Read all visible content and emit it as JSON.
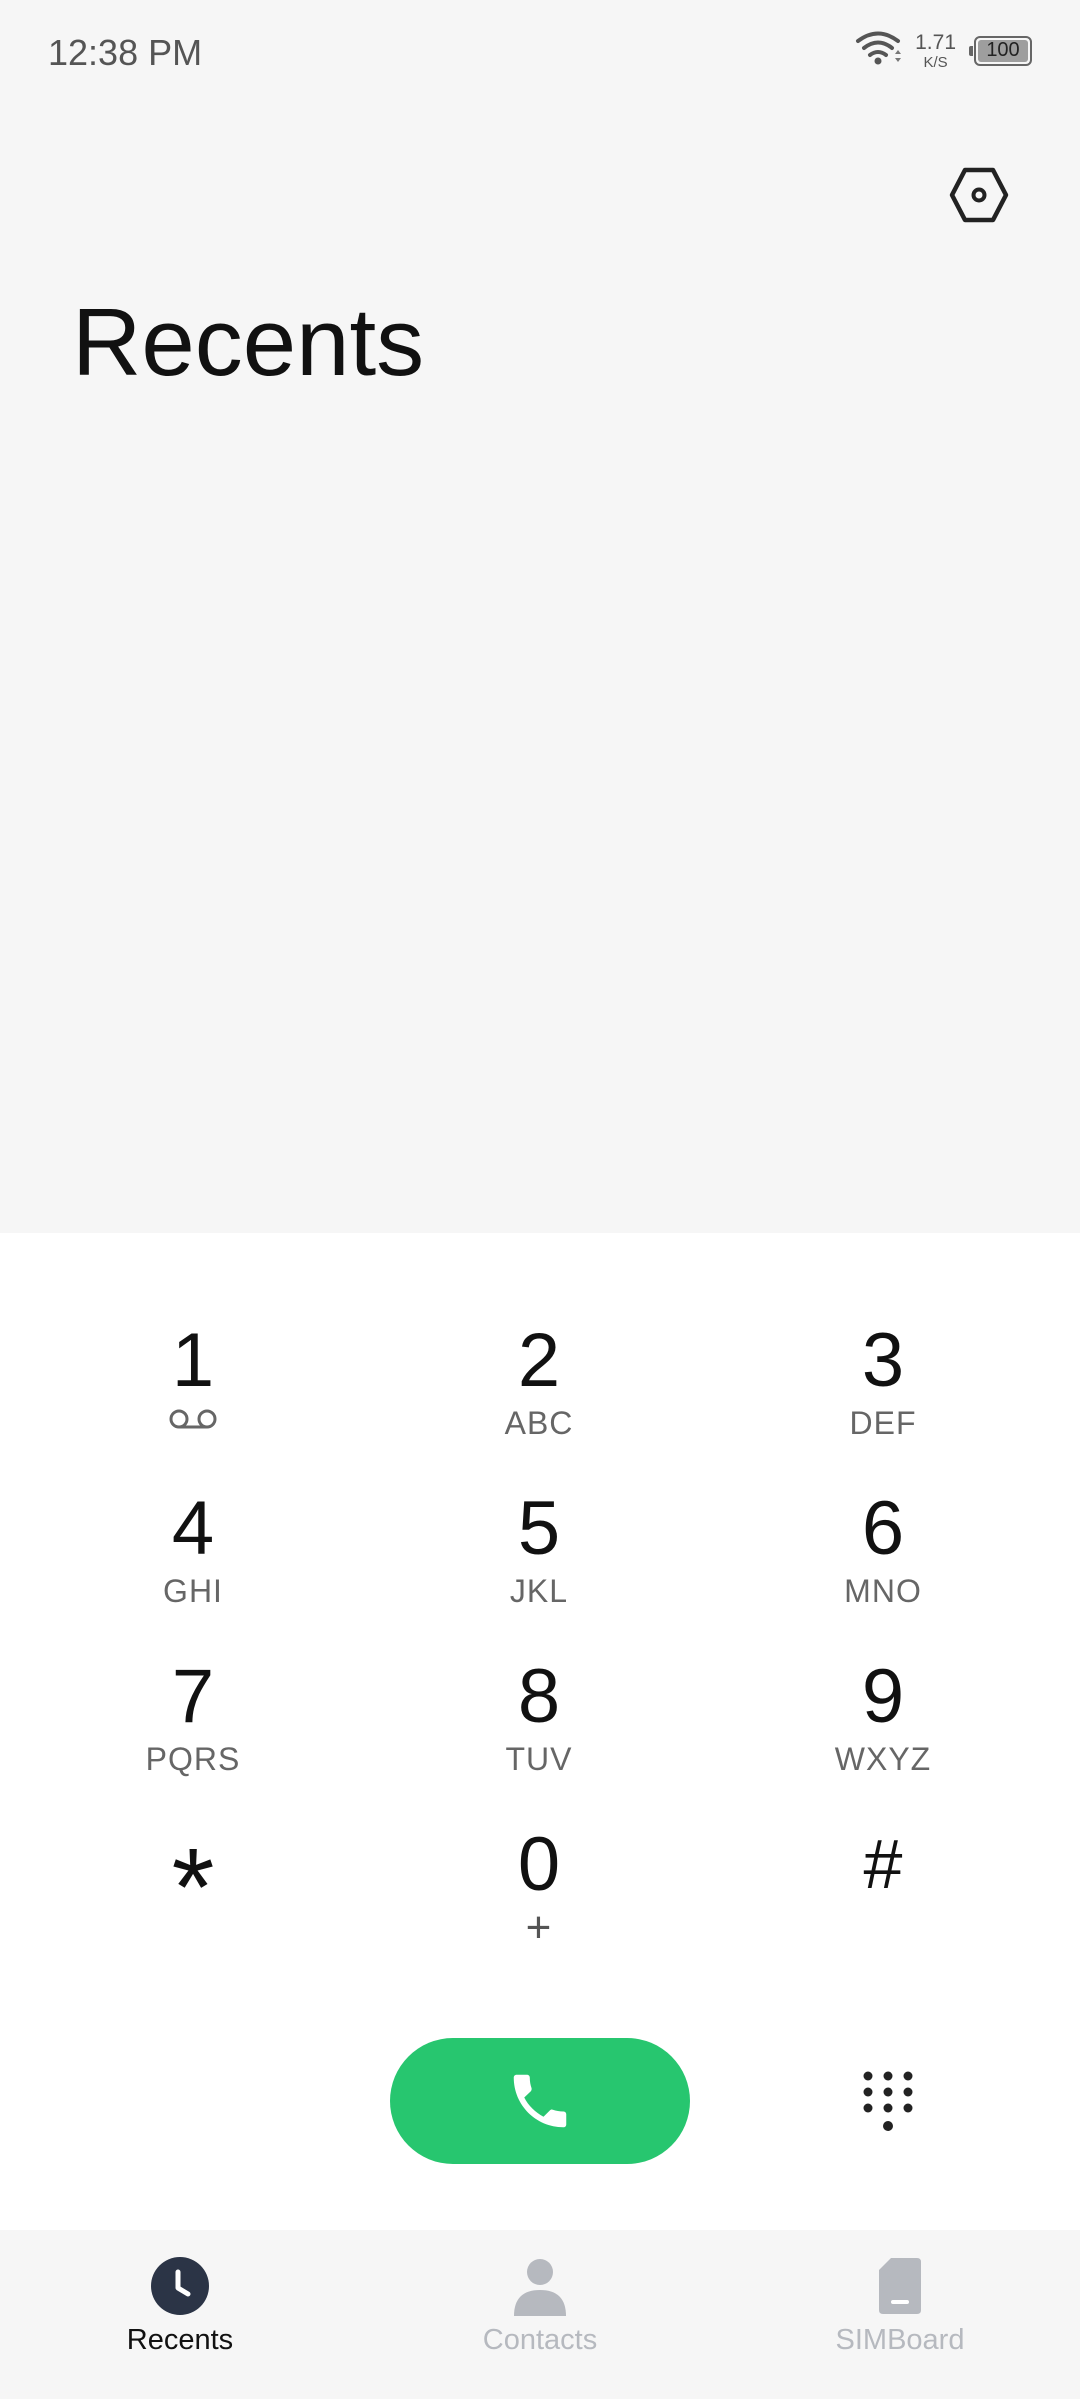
{
  "status_bar": {
    "time": "12:38 PM",
    "net_speed_value": "1.71",
    "net_speed_unit": "K/S",
    "battery": "100",
    "icons": [
      "wifi-icon",
      "battery-icon"
    ]
  },
  "header": {
    "title": "Recents",
    "settings_icon": "settings-hexagon-icon"
  },
  "dialpad": {
    "keys": [
      {
        "digit": "1",
        "letters": "",
        "icon": "voicemail-icon"
      },
      {
        "digit": "2",
        "letters": "ABC"
      },
      {
        "digit": "3",
        "letters": "DEF"
      },
      {
        "digit": "4",
        "letters": "GHI"
      },
      {
        "digit": "5",
        "letters": "JKL"
      },
      {
        "digit": "6",
        "letters": "MNO"
      },
      {
        "digit": "7",
        "letters": "PQRS"
      },
      {
        "digit": "8",
        "letters": "TUV"
      },
      {
        "digit": "9",
        "letters": "WXYZ"
      },
      {
        "digit": "*",
        "letters": ""
      },
      {
        "digit": "0",
        "letters": "+"
      },
      {
        "digit": "#",
        "letters": ""
      }
    ]
  },
  "actions": {
    "call_icon": "phone-icon",
    "dialpad_toggle_icon": "dialpad-icon"
  },
  "bottom_nav": {
    "items": [
      {
        "label": "Recents",
        "icon": "clock-icon",
        "active": true
      },
      {
        "label": "Contacts",
        "icon": "person-icon",
        "active": false
      },
      {
        "label": "SIMBoard",
        "icon": "sim-card-icon",
        "active": false
      }
    ]
  },
  "colors": {
    "background": "#f6f6f6",
    "dialpad_background": "#ffffff",
    "call_green": "#27c66f",
    "active_nav_icon": "#2b3446",
    "inactive_nav": "#b6b9bf"
  }
}
